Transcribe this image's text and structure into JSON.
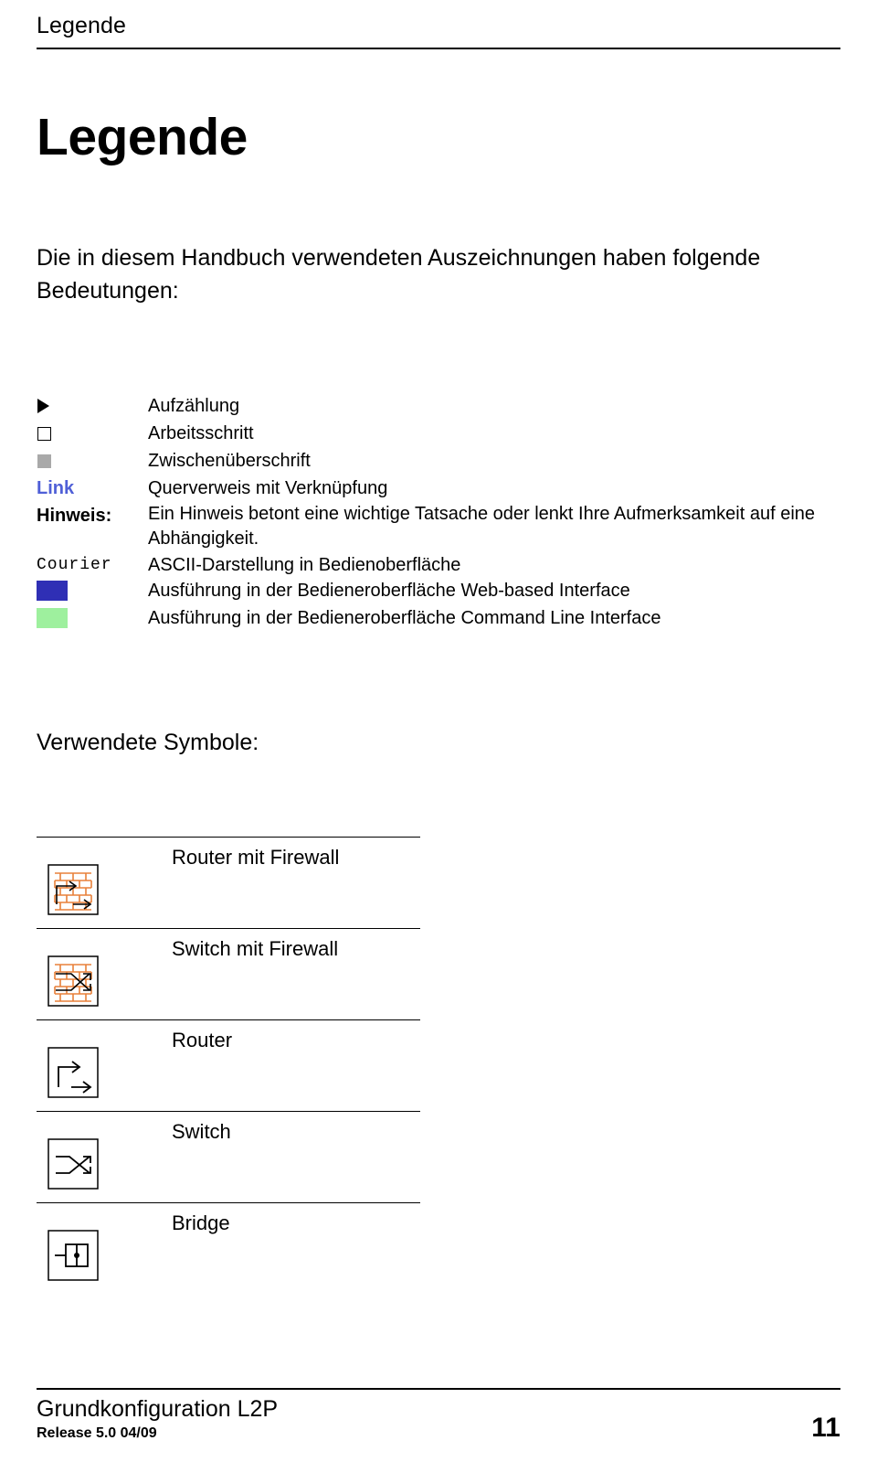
{
  "header": {
    "running_title": "Legende"
  },
  "chapter": {
    "title": "Legende"
  },
  "intro": {
    "text": "Die in diesem Handbuch verwendeten Auszeichnungen haben folgende Bedeutungen:"
  },
  "legend": {
    "rows": [
      {
        "key": "",
        "key_kind": "triangle-bullet",
        "value": "Aufzählung"
      },
      {
        "key": "",
        "key_kind": "open-square-bullet",
        "value": "Arbeitsschritt"
      },
      {
        "key": "",
        "key_kind": "grey-square-bullet",
        "value": "Zwischenüberschrift"
      },
      {
        "key": "Link",
        "key_kind": "link-text",
        "value": "Querverweis mit Verknüpfung"
      },
      {
        "key": "Hinweis:",
        "key_kind": "bold-text",
        "value": "Ein Hinweis betont eine wichtige Tatsache oder lenkt Ihre Aufmerksamkeit auf eine Abhängigkeit."
      },
      {
        "key": "Courier",
        "key_kind": "courier-text",
        "value": "ASCII-Darstellung in Bedienoberfläche"
      },
      {
        "key": "",
        "key_kind": "blue-swatch",
        "value": "Ausführung in der Bedieneroberfläche Web-based Interface"
      },
      {
        "key": "",
        "key_kind": "green-swatch",
        "value": "Ausführung in der Bedieneroberfläche Command Line Interface"
      }
    ]
  },
  "symbols": {
    "title": "Verwendete Symbole:",
    "items": [
      {
        "label": "Router mit Firewall",
        "icon": "router-with-firewall-icon"
      },
      {
        "label": "Switch mit Firewall",
        "icon": "switch-with-firewall-icon"
      },
      {
        "label": "Router",
        "icon": "router-icon"
      },
      {
        "label": "Switch",
        "icon": "switch-icon"
      },
      {
        "label": "Bridge",
        "icon": "bridge-icon"
      }
    ]
  },
  "footer": {
    "doc_title": "Grundkonfiguration L2P",
    "release": "Release 5.0 04/09",
    "page_number": "11"
  },
  "colors": {
    "link": "#4f5fd7",
    "web_interface_swatch": "#2f2fb5",
    "cli_swatch": "#9ef09e",
    "grey_square": "#a9a9a9",
    "firewall_brick": "#e8803a"
  }
}
